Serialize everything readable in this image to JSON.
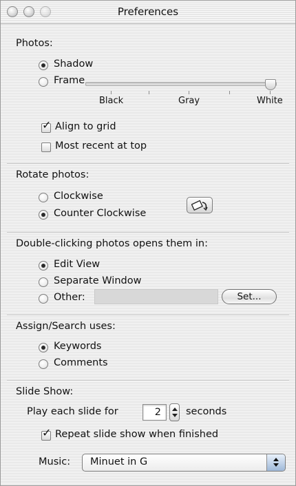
{
  "window": {
    "title": "Preferences"
  },
  "photos": {
    "heading": "Photos:",
    "shadow_label": "Shadow",
    "frame_label": "Frame",
    "selected": "Shadow",
    "frame_color": {
      "labels": [
        "Black",
        "Gray",
        "White"
      ],
      "value": "White"
    },
    "align_to_grid_label": "Align to grid",
    "align_to_grid_checked": true,
    "most_recent_label": "Most recent at top",
    "most_recent_checked": false
  },
  "rotate": {
    "heading": "Rotate photos:",
    "clockwise_label": "Clockwise",
    "counter_label": "Counter Clockwise",
    "selected": "Counter Clockwise"
  },
  "double_click": {
    "heading": "Double-clicking photos opens them in:",
    "edit_view_label": "Edit View",
    "separate_window_label": "Separate Window",
    "other_label": "Other:",
    "other_value": "",
    "set_button_label": "Set...",
    "selected": "Edit View"
  },
  "assign_search": {
    "heading": "Assign/Search uses:",
    "keywords_label": "Keywords",
    "comments_label": "Comments",
    "selected": "Keywords"
  },
  "slide_show": {
    "heading": "Slide Show:",
    "play_prefix": "Play each slide for",
    "seconds_value": "2",
    "play_suffix": "seconds",
    "repeat_label": "Repeat slide show when finished",
    "repeat_checked": true,
    "music_label": "Music:",
    "music_value": "Minuet in G"
  }
}
